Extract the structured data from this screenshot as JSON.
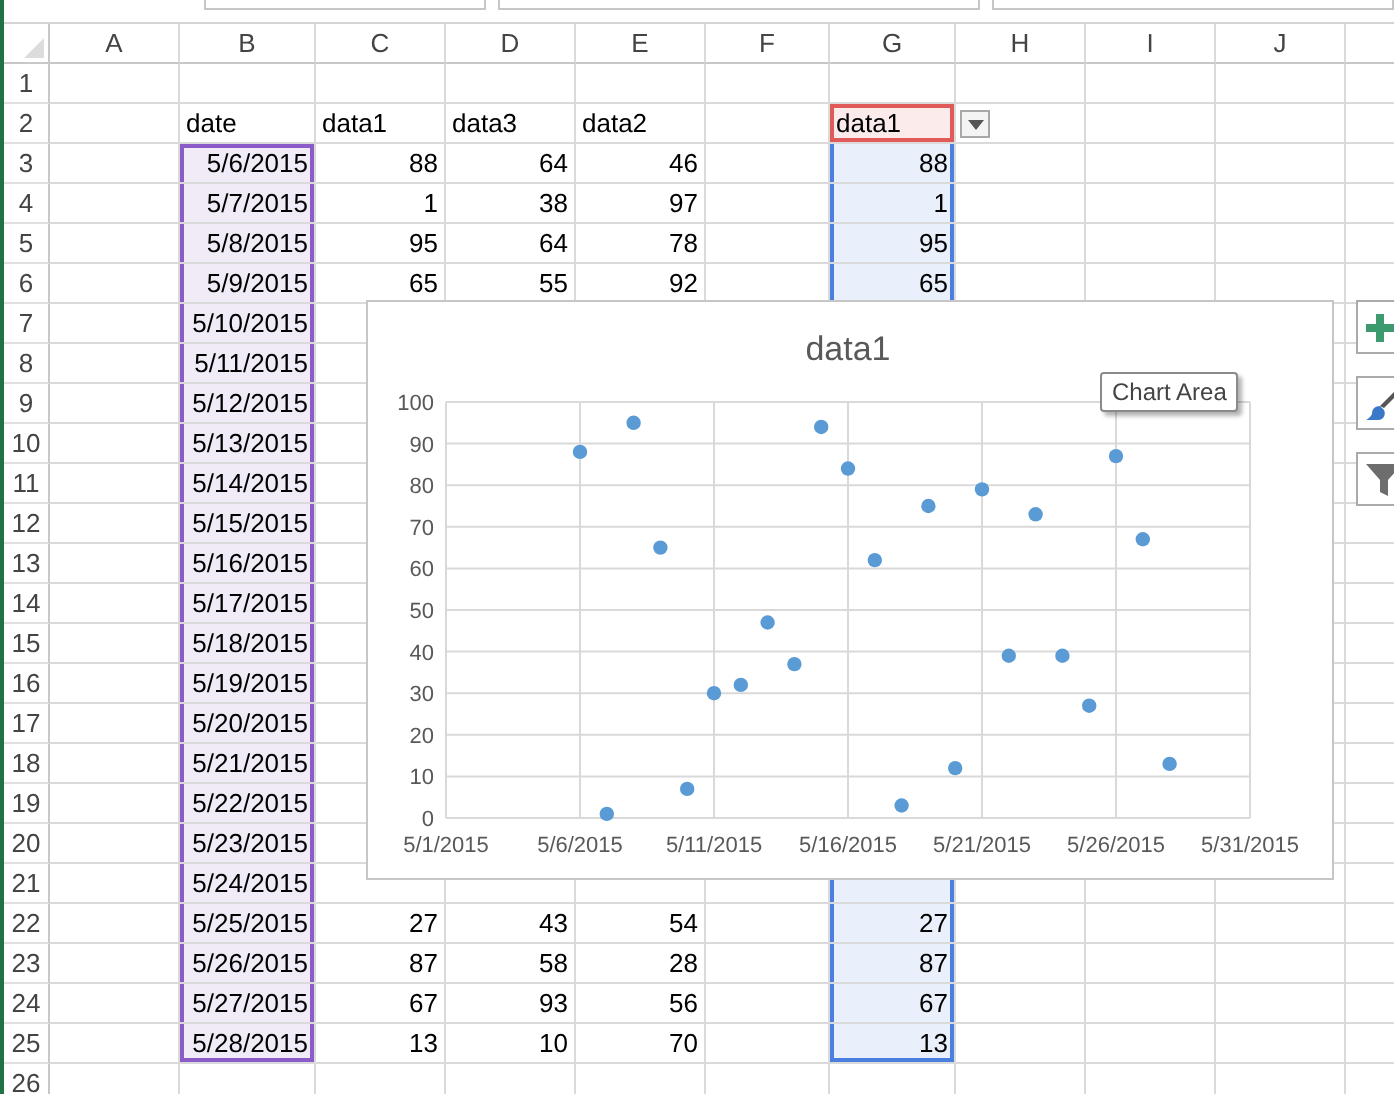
{
  "columns": [
    {
      "label": "A"
    },
    {
      "label": "B",
      "x_range": true
    },
    {
      "label": "C"
    },
    {
      "label": "D"
    },
    {
      "label": "E"
    },
    {
      "label": "F"
    },
    {
      "label": "G",
      "y_range": true,
      "name_range": true
    },
    {
      "label": "H"
    },
    {
      "label": "I"
    },
    {
      "label": "J"
    }
  ],
  "rows": [
    {
      "label": "1",
      "kind": "empty",
      "in_range": false,
      "cells": []
    },
    {
      "label": "2",
      "kind": "header",
      "in_range": false,
      "range_header": true,
      "filter_button": true,
      "cells": [
        null,
        "date",
        "data1",
        "data3",
        "data2",
        null,
        "data1"
      ]
    },
    {
      "label": "3",
      "kind": "data",
      "in_range": true,
      "cells": [
        null,
        "5/6/2015",
        "88",
        "64",
        "46",
        null,
        "88"
      ]
    },
    {
      "label": "4",
      "kind": "data",
      "in_range": true,
      "cells": [
        null,
        "5/7/2015",
        "1",
        "38",
        "97",
        null,
        "1"
      ]
    },
    {
      "label": "5",
      "kind": "data",
      "in_range": true,
      "cells": [
        null,
        "5/8/2015",
        "95",
        "64",
        "78",
        null,
        "95"
      ]
    },
    {
      "label": "6",
      "kind": "data",
      "in_range": true,
      "cells": [
        null,
        "5/9/2015",
        "65",
        "55",
        "92",
        null,
        "65"
      ]
    },
    {
      "label": "7",
      "kind": "data",
      "in_range": true,
      "cells": [
        null,
        "5/10/2015"
      ]
    },
    {
      "label": "8",
      "kind": "data",
      "in_range": true,
      "cells": [
        null,
        "5/11/2015"
      ]
    },
    {
      "label": "9",
      "kind": "data",
      "in_range": true,
      "cells": [
        null,
        "5/12/2015"
      ]
    },
    {
      "label": "10",
      "kind": "data",
      "in_range": true,
      "cells": [
        null,
        "5/13/2015"
      ]
    },
    {
      "label": "11",
      "kind": "data",
      "in_range": true,
      "cells": [
        null,
        "5/14/2015"
      ]
    },
    {
      "label": "12",
      "kind": "data",
      "in_range": true,
      "cells": [
        null,
        "5/15/2015"
      ]
    },
    {
      "label": "13",
      "kind": "data",
      "in_range": true,
      "cells": [
        null,
        "5/16/2015"
      ]
    },
    {
      "label": "14",
      "kind": "data",
      "in_range": true,
      "cells": [
        null,
        "5/17/2015"
      ]
    },
    {
      "label": "15",
      "kind": "data",
      "in_range": true,
      "cells": [
        null,
        "5/18/2015"
      ]
    },
    {
      "label": "16",
      "kind": "data",
      "in_range": true,
      "cells": [
        null,
        "5/19/2015"
      ]
    },
    {
      "label": "17",
      "kind": "data",
      "in_range": true,
      "cells": [
        null,
        "5/20/2015"
      ]
    },
    {
      "label": "18",
      "kind": "data",
      "in_range": true,
      "cells": [
        null,
        "5/21/2015"
      ]
    },
    {
      "label": "19",
      "kind": "data",
      "in_range": true,
      "cells": [
        null,
        "5/22/2015"
      ]
    },
    {
      "label": "20",
      "kind": "data",
      "in_range": true,
      "cells": [
        null,
        "5/23/2015"
      ]
    },
    {
      "label": "21",
      "kind": "data",
      "in_range": true,
      "cells": [
        null,
        "5/24/2015"
      ]
    },
    {
      "label": "22",
      "kind": "data",
      "in_range": true,
      "cells": [
        null,
        "5/25/2015",
        "27",
        "43",
        "54",
        null,
        "27"
      ]
    },
    {
      "label": "23",
      "kind": "data",
      "in_range": true,
      "cells": [
        null,
        "5/26/2015",
        "87",
        "58",
        "28",
        null,
        "87"
      ]
    },
    {
      "label": "24",
      "kind": "data",
      "in_range": true,
      "cells": [
        null,
        "5/27/2015",
        "67",
        "93",
        "56",
        null,
        "67"
      ]
    },
    {
      "label": "25",
      "kind": "data",
      "in_range": true,
      "cells": [
        null,
        "5/28/2015",
        "13",
        "10",
        "70",
        null,
        "13"
      ]
    },
    {
      "label": "26",
      "kind": "empty",
      "in_range": false,
      "cells": []
    }
  ],
  "chart": {
    "tooltip": "Chart Area",
    "chart_data": {
      "type": "scatter",
      "title": "data1",
      "categories": [
        "5/1/2015",
        null,
        null,
        null,
        null,
        "5/6/2015",
        null,
        null,
        null,
        null,
        "5/11/2015",
        null,
        null,
        null,
        null,
        "5/16/2015",
        null,
        null,
        null,
        null,
        "5/21/2015",
        null,
        null,
        null,
        null,
        "5/26/2015",
        null,
        null,
        null,
        null,
        "5/31/2015"
      ],
      "series": [
        {
          "color": "#5b9bd5",
          "values": [
            null,
            null,
            null,
            null,
            null,
            88,
            1,
            95,
            65,
            7,
            30,
            32,
            47,
            37,
            94,
            84,
            62,
            3,
            75,
            12,
            79,
            39,
            73,
            39,
            27,
            87,
            67,
            13,
            null,
            null,
            null
          ]
        }
      ],
      "ylim": [
        0,
        100
      ],
      "grid": true,
      "yticks": [
        {
          "value": 0,
          "label": "0"
        },
        {
          "value": 10,
          "label": "10"
        },
        {
          "value": 20,
          "label": "20"
        },
        {
          "value": 30,
          "label": "30"
        },
        {
          "value": 40,
          "label": "40"
        },
        {
          "value": 50,
          "label": "50"
        },
        {
          "value": 60,
          "label": "60"
        },
        {
          "value": 70,
          "label": "70"
        },
        {
          "value": 80,
          "label": "80"
        },
        {
          "value": 90,
          "label": "90"
        },
        {
          "value": 100,
          "label": "100"
        }
      ]
    }
  }
}
